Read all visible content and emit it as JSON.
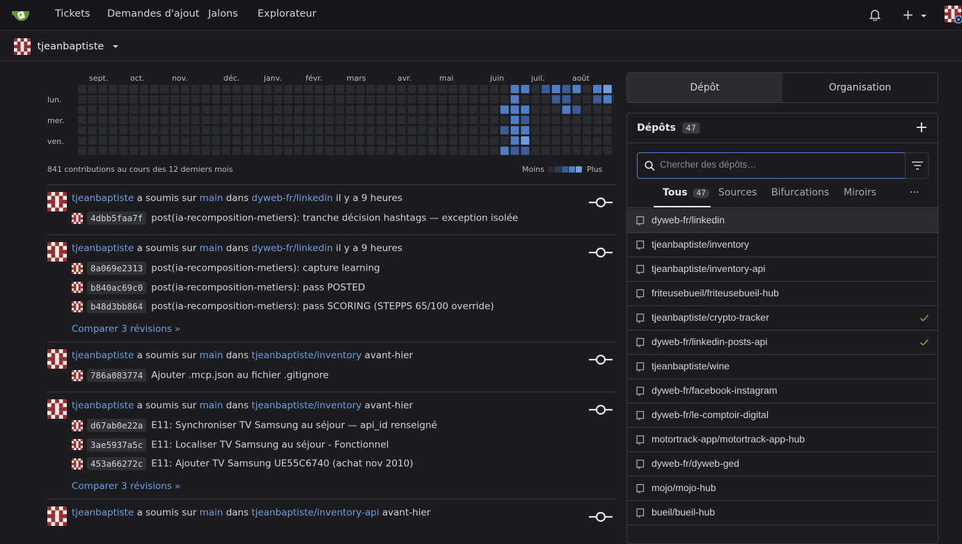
{
  "nav": {
    "items": [
      "Tickets",
      "Demandes d'ajout",
      "Jalons",
      "Explorateur"
    ],
    "plus": "+"
  },
  "context": {
    "user": "tjeanbaptiste"
  },
  "heatmap": {
    "months": [
      "sept.",
      "oct.",
      "nov.",
      "déc.",
      "janv.",
      "févr.",
      "mars",
      "avr.",
      "mai",
      "juin",
      "juil.",
      "août"
    ],
    "days": [
      "lun.",
      "mer.",
      "ven."
    ],
    "summary": "841 contributions au cours des 12 derniers mois",
    "less": "Moins",
    "more": "Plus",
    "colors": [
      "#2a2b2e",
      "#2b3c5a",
      "#3b5c94",
      "#4f7ec7",
      "#6f9be0"
    ],
    "levels": {
      "41": [
        0,
        0,
        3,
        0,
        2,
        0,
        3
      ],
      "42": [
        3,
        3,
        3,
        3,
        3,
        3,
        2
      ],
      "43": [
        3,
        0,
        3,
        2,
        3,
        4,
        2
      ],
      "44": [
        0,
        0,
        0,
        0,
        0,
        0,
        0
      ],
      "45": [
        2,
        0,
        0,
        0,
        0,
        0,
        0
      ],
      "46": [
        3,
        2,
        0,
        0,
        0,
        0,
        0
      ],
      "47": [
        2,
        2,
        3,
        0,
        0,
        0,
        0
      ],
      "48": [
        3,
        0,
        2,
        0,
        0,
        0,
        0
      ],
      "49": [
        0,
        0,
        0,
        0,
        0,
        0,
        0
      ],
      "50": [
        3,
        2,
        0,
        0,
        0,
        0,
        0
      ],
      "51": [
        4,
        3,
        0,
        0,
        0,
        0,
        0
      ],
      "52": [
        0,
        3,
        0,
        0,
        0,
        0,
        0
      ]
    }
  },
  "feed": {
    "verb": "a soumis sur",
    "in": "dans",
    "items": [
      {
        "user": "tjeanbaptiste",
        "branch": "main",
        "repo": "dyweb-fr/linkedin",
        "time": "il y a 9 heures",
        "commits": [
          {
            "sha": "4dbb5faa7f",
            "msg": "post(ia-recomposition-metiers): tranche décision hashtags — exception isolée"
          }
        ]
      },
      {
        "user": "tjeanbaptiste",
        "branch": "main",
        "repo": "dyweb-fr/linkedin",
        "time": "il y a 9 heures",
        "commits": [
          {
            "sha": "8a069e2313",
            "msg": "post(ia-recomposition-metiers): capture learning"
          },
          {
            "sha": "b840ac69c0",
            "msg": "post(ia-recomposition-metiers): pass POSTED"
          },
          {
            "sha": "b48d3bb864",
            "msg": "post(ia-recomposition-metiers): pass SCORING (STEPPS 65/100 override)"
          }
        ],
        "compare": "Comparer 3 révisions »"
      },
      {
        "user": "tjeanbaptiste",
        "branch": "main",
        "repo": "tjeanbaptiste/inventory",
        "time": "avant-hier",
        "commits": [
          {
            "sha": "786a083774",
            "msg": "Ajouter .mcp.json au fichier .gitignore"
          }
        ]
      },
      {
        "user": "tjeanbaptiste",
        "branch": "main",
        "repo": "tjeanbaptiste/inventory",
        "time": "avant-hier",
        "commits": [
          {
            "sha": "d67ab0e22a",
            "msg": "E11: Synchroniser TV Samsung au séjour — api_id renseigné"
          },
          {
            "sha": "3ae5937a5c",
            "msg": "E11: Localiser TV Samsung au séjour - Fonctionnel"
          },
          {
            "sha": "453a66272c",
            "msg": "E11: Ajouter TV Samsung UE55C6740 (achat nov 2010)"
          }
        ],
        "compare": "Comparer 3 révisions »"
      },
      {
        "user": "tjeanbaptiste",
        "branch": "main",
        "repo": "tjeanbaptiste/inventory-api",
        "time": "avant-hier",
        "commits": []
      }
    ]
  },
  "side": {
    "tab_repo": "Dépôt",
    "tab_org": "Organisation",
    "title": "Dépôts",
    "count": "47",
    "add": "+",
    "search_placeholder": "Chercher des dépôts…",
    "filters": {
      "all": "Tous",
      "all_count": "47",
      "sources": "Sources",
      "forks": "Bifurcations",
      "mirrors": "Miroirs",
      "more": "···"
    },
    "repos": [
      {
        "name": "dyweb-fr/linkedin",
        "check": false
      },
      {
        "name": "tjeanbaptiste/inventory",
        "check": false
      },
      {
        "name": "tjeanbaptiste/inventory-api",
        "check": false
      },
      {
        "name": "friteusebueil/friteusebueil-hub",
        "check": false
      },
      {
        "name": "tjeanbaptiste/crypto-tracker",
        "check": true
      },
      {
        "name": "dyweb-fr/linkedin-posts-api",
        "check": true
      },
      {
        "name": "tjeanbaptiste/wine",
        "check": false
      },
      {
        "name": "dyweb-fr/facebook-instagram",
        "check": false
      },
      {
        "name": "dyweb-fr/le-comptoir-digital",
        "check": false
      },
      {
        "name": "motortrack-app/motortrack-app-hub",
        "check": false
      },
      {
        "name": "dyweb-fr/dyweb-ged",
        "check": false
      },
      {
        "name": "mojo/mojo-hub",
        "check": false
      },
      {
        "name": "bueil/bueil-hub",
        "check": false
      }
    ]
  }
}
